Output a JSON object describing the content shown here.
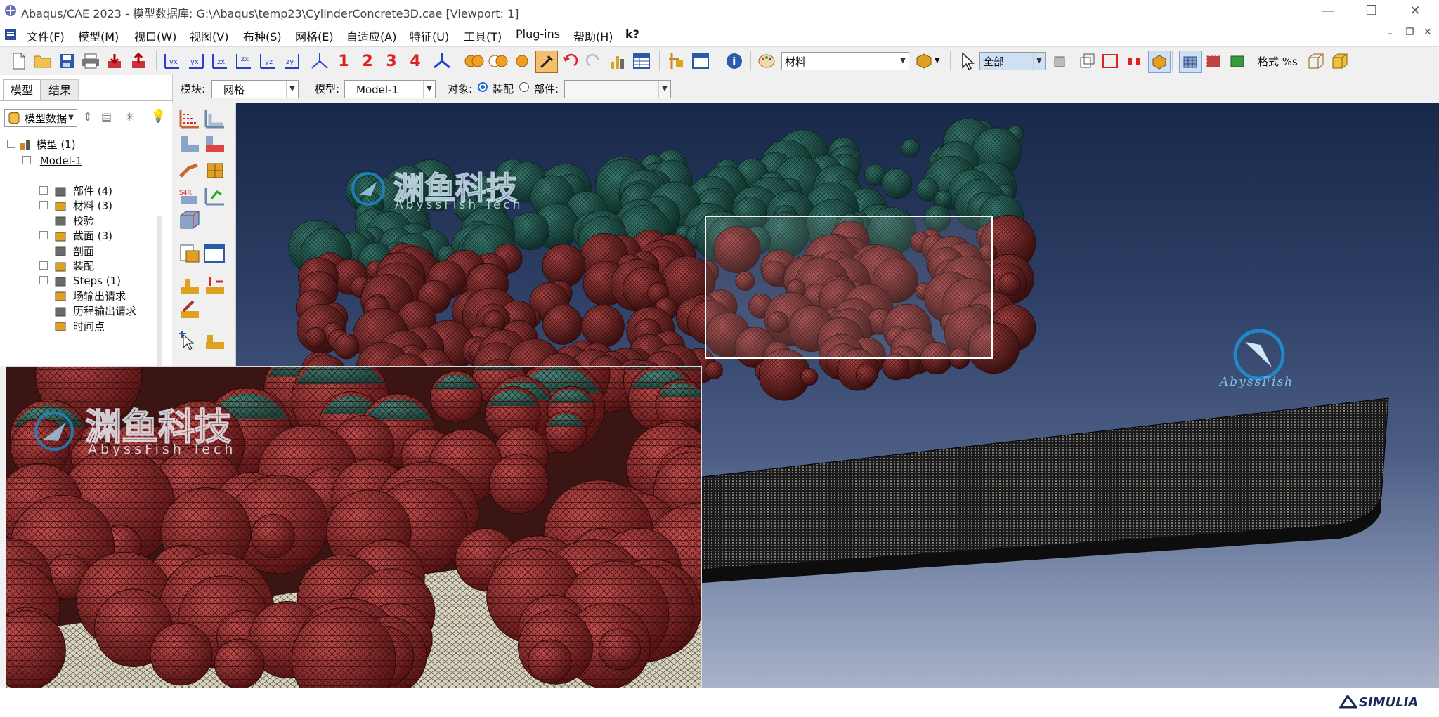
{
  "window": {
    "title": "Abaqus/CAE 2023 - 模型数据库: G:\\Abaqus\\temp23\\CylinderConcrete3D.cae [Viewport: 1]",
    "icon": "abaqus-logo-icon"
  },
  "menubar": {
    "items": [
      "文件(F)",
      "模型(M)",
      "视口(W)",
      "视图(V)",
      "布种(S)",
      "网格(E)",
      "自适应(A)",
      "特征(U)",
      "工具(T)",
      "Plug-ins",
      "帮助(H)",
      "k?"
    ]
  },
  "toolbar": {
    "view_numbers": [
      "1",
      "2",
      "3",
      "4"
    ],
    "material_select": "材料",
    "selection_filter": "全部",
    "format_label": "格式 %s"
  },
  "context": {
    "module_label": "模块:",
    "module_value": "网格",
    "model_label": "模型:",
    "model_value": "Model-1",
    "object_label": "对象:",
    "object_assembly": "装配",
    "object_part": "部件:",
    "part_value": ""
  },
  "left_panel": {
    "tabs": [
      "模型",
      "结果"
    ],
    "db_select": "模型数据",
    "tree": {
      "root": "模型 (1)",
      "model": "Model-1",
      "items": [
        {
          "label": "部件 (4)",
          "icon": "part-icon",
          "expandable": true
        },
        {
          "label": "材料 (3)",
          "icon": "material-icon",
          "expandable": true
        },
        {
          "label": "校验",
          "icon": "calibration-icon",
          "expandable": false
        },
        {
          "label": "截面 (3)",
          "icon": "section-icon",
          "expandable": true
        },
        {
          "label": "剖面",
          "icon": "profile-icon",
          "expandable": false
        },
        {
          "label": "装配",
          "icon": "assembly-icon",
          "expandable": true
        },
        {
          "label": "Steps (1)",
          "icon": "steps-icon",
          "expandable": true
        },
        {
          "label": "场输出请求",
          "icon": "field-output-icon",
          "expandable": false
        },
        {
          "label": "历程输出请求",
          "icon": "history-output-icon",
          "expandable": false
        },
        {
          "label": "时间点",
          "icon": "time-points-icon",
          "expandable": false
        }
      ]
    }
  },
  "watermark": {
    "cn_text": "渊鱼科技",
    "en_text": "AbyssFish Tech",
    "brand_text": "AbyssFish"
  },
  "status": {
    "brand": "SIMULIA"
  },
  "colors": {
    "red_aggregate": "#8e2a2a",
    "green_aggregate": "#1f5a50",
    "viewport_top": "#18284a",
    "viewport_bottom": "#a8b2c8",
    "selection_box": "#ffffff",
    "accent_blue": "#1b6fd6"
  }
}
